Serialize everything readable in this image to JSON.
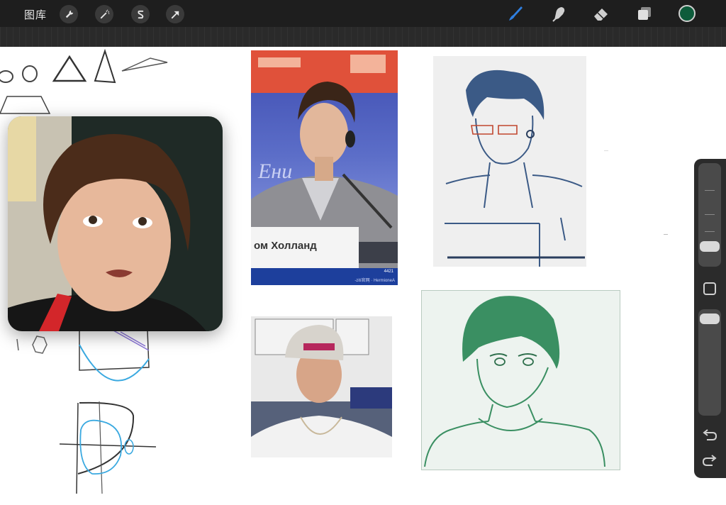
{
  "toolbar": {
    "gallery_label": "图库",
    "actions": [
      "wrench-icon",
      "magic-wand-icon",
      "selection-s-icon",
      "transform-arrow-icon"
    ],
    "tools": [
      "brush-icon",
      "smudge-icon",
      "eraser-icon",
      "layers-icon"
    ],
    "current_color": "#0d5c3b",
    "brush_color": "#2f7fe0"
  },
  "canvas": {
    "photo_sign_text": "ом Холланд",
    "photo_watermark": "-ziti官网 · HermioneA",
    "photo_badge": "4421"
  }
}
